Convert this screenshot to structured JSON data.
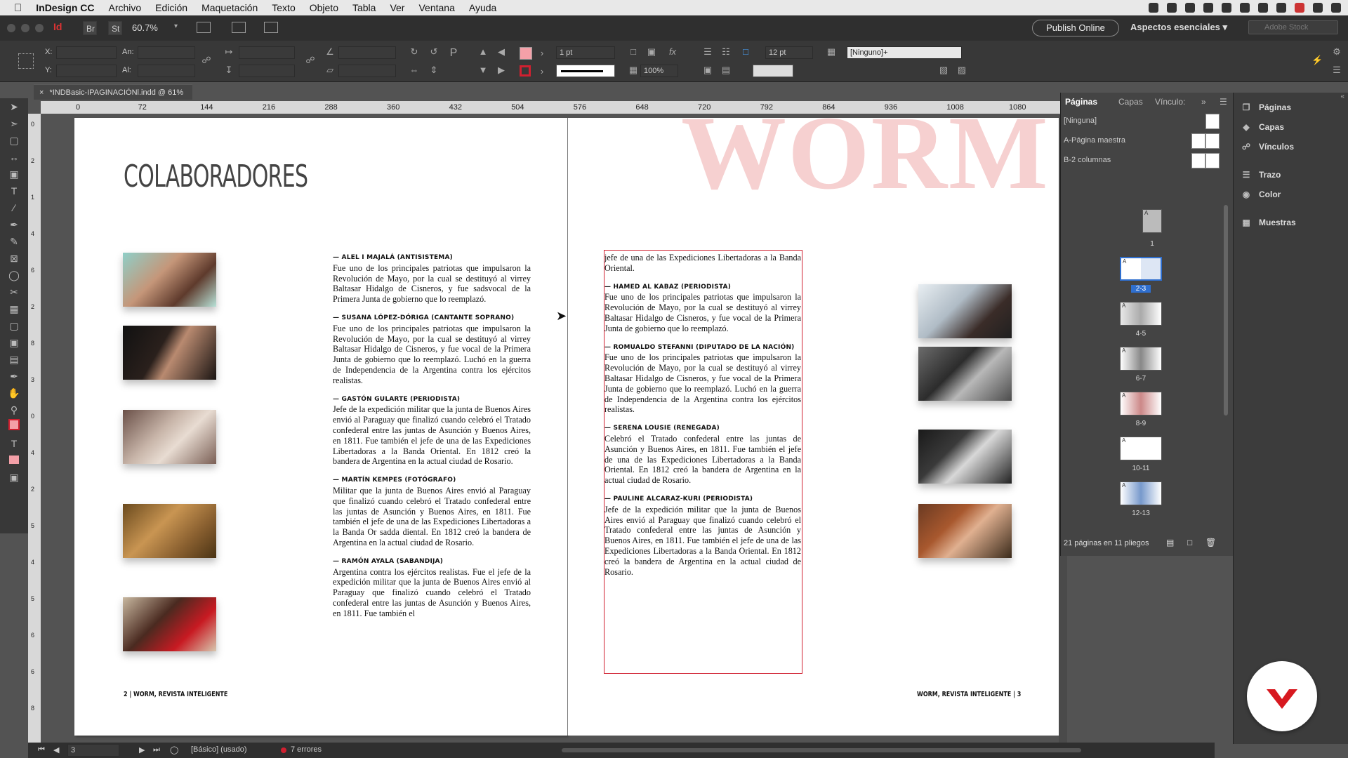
{
  "menubar": {
    "app": "InDesign CC",
    "items": [
      "Archivo",
      "Edición",
      "Maquetación",
      "Texto",
      "Objeto",
      "Tabla",
      "Ver",
      "Ventana",
      "Ayuda"
    ]
  },
  "apptop": {
    "br": "Br",
    "st": "St",
    "zoom": "60.7%",
    "publish": "Publish Online",
    "workspace": "Aspectos esenciales",
    "stock_placeholder": "Adobe Stock"
  },
  "control": {
    "x_label": "X:",
    "y_label": "Y:",
    "w_label": "An:",
    "h_label": "Al:",
    "stroke_weight": "1 pt",
    "opacity": "100%",
    "gutter": "12 pt",
    "object_style": "[Ninguno]+"
  },
  "document": {
    "tab_title": "*INDBasic-IPAGINACIÓNl.indd @ 61%",
    "close": "×",
    "ruler_ticks": [
      "0",
      "72",
      "144",
      "216",
      "288",
      "360",
      "432",
      "504",
      "576",
      "648",
      "720",
      "792",
      "864",
      "936",
      "1008",
      "1080"
    ],
    "ruler_v_ticks": [
      "0",
      "2",
      "1",
      "4",
      "6",
      "2",
      "8",
      "3",
      "0",
      "4",
      "2",
      "5",
      "4",
      "5",
      "6",
      "6",
      "8"
    ]
  },
  "spread": {
    "heading": "COLABORADORES",
    "deco_title": "WORM",
    "folio_left": "2 | WORM, REVISTA INTELIGENTE",
    "folio_right": "WORM, REVISTA INTELIGENTE | 3",
    "left_column": [
      {
        "name": "— ALEL I MAJALÁ (ANTISISTEMA)",
        "text": "Fue uno de los principales patriotas que impulsaron la Revolución de Mayo, por la cual se destituyó al virrey Baltasar Hidalgo de Cisneros, y fue sadsvocal de la Primera Junta de gobierno que lo reemplazó."
      },
      {
        "name": "— SUSANA LÓPEZ-DÓRIGA (CANTANTE SOPRANO)",
        "text": "Fue uno de los principales patriotas que impulsaron la Revolución de Mayo, por la cual se destituyó al virrey Baltasar Hidalgo de Cisneros, y fue vocal de la Primera Junta de gobierno que lo reemplazó. Luchó en la guerra de Independencia de la Argentina contra los ejércitos realistas."
      },
      {
        "name": "— GASTÓN GULARTE (PERIODISTA)",
        "text": "Jefe de la expedición militar que la junta de Buenos Aires envió al Paraguay que finalizó cuando celebró el Tratado confederal entre las juntas de Asunción y Buenos Aires, en 1811. Fue también el jefe de una de las Expediciones Libertadoras a la Banda Oriental. En 1812 creó la bandera de Argentina en la actual ciudad de Rosario."
      },
      {
        "name": "— MARTÍN KEMPES (FOTÓGRAFO)",
        "text": "Militar que la junta de Buenos Aires envió al Paraguay que finalizó cuando celebró el Tratado confederal entre las juntas de Asunción y Buenos Aires, en 1811. Fue también el jefe de una de las Expediciones Libertadoras a la Banda Or sadda diental. En 1812 creó la bandera de Argentina en la actual ciudad de Rosario."
      },
      {
        "name": "— RAMÓN AYALA (SABANDIJA)",
        "text": "Argentina contra los ejércitos realistas. Fue el jefe de la expedición militar que la junta de Buenos Aires envió al Paraguay que finalizó cuando celebró el Tratado confederal entre las juntas de Asunción y Buenos Aires, en 1811. Fue también el"
      }
    ],
    "right_column_lead": "jefe de una de las Expediciones Libertadoras a la Banda Oriental.",
    "right_column": [
      {
        "name": "— HAMED AL KABAZ (PERIODISTA)",
        "text": "Fue uno de los principales patriotas que impulsaron la Revolución de Mayo, por la cual se destituyó al virrey Baltasar Hidalgo de Cisneros, y fue vocal de la Primera Junta de gobierno que lo reemplazó."
      },
      {
        "name": "— ROMUALDO STEFANNI (DIPUTADO DE LA NACIÓN)",
        "text": "Fue uno de los principales patriotas que impulsaron la Revolución de Mayo, por la cual se destituyó al virrey Baltasar Hidalgo de Cisneros, y fue vocal de la Primera Junta de gobierno que lo reemplazó. Luchó en la guerra de Independencia de la Argentina contra los ejércitos realistas."
      },
      {
        "name": "— SERENA LOUSIE (RENEGADA)",
        "text": "Celebró el Tratado confederal entre las juntas de Asunción y Buenos Aires, en 1811. Fue también el jefe de una de las Expediciones Libertadoras a la Banda Oriental. En 1812 creó la bandera de Argentina en la actual ciudad de Rosario."
      },
      {
        "name": "— PAULINE ALCARAZ-KURI (PERIODISTA)",
        "text": "Jefe de la expedición militar que la junta de Buenos Aires envió al Paraguay que finalizó cuando celebró el Tratado confederal entre las juntas de Asunción y Buenos Aires, en 1811. Fue también el jefe de una de las Expediciones Libertadoras a la Banda Oriental. En 1812 creó la bandera de Argentina en la actual ciudad de Rosario."
      }
    ]
  },
  "pages_panel": {
    "tabs": [
      "Páginas",
      "Capas",
      "Vínculo:"
    ],
    "masters": [
      "[Ninguna]",
      "A-Página maestra",
      "B-2 columnas"
    ],
    "spreads": [
      "1",
      "2-3",
      "4-5",
      "6-7",
      "8-9",
      "10-11",
      "12-13"
    ],
    "master_letter": "A",
    "footer": "21 páginas en 11 pliegos"
  },
  "dock": {
    "items": [
      "Páginas",
      "Capas",
      "Vínculos",
      "Trazo",
      "Color",
      "Muestras"
    ]
  },
  "status": {
    "page": "3",
    "profile": "[Básico] (usado)",
    "errors": "7 errores"
  },
  "colors": {
    "accent_red": "#d02030",
    "deco_pink": "#f6d0d0",
    "selected_spread": "#2f6fcf"
  }
}
